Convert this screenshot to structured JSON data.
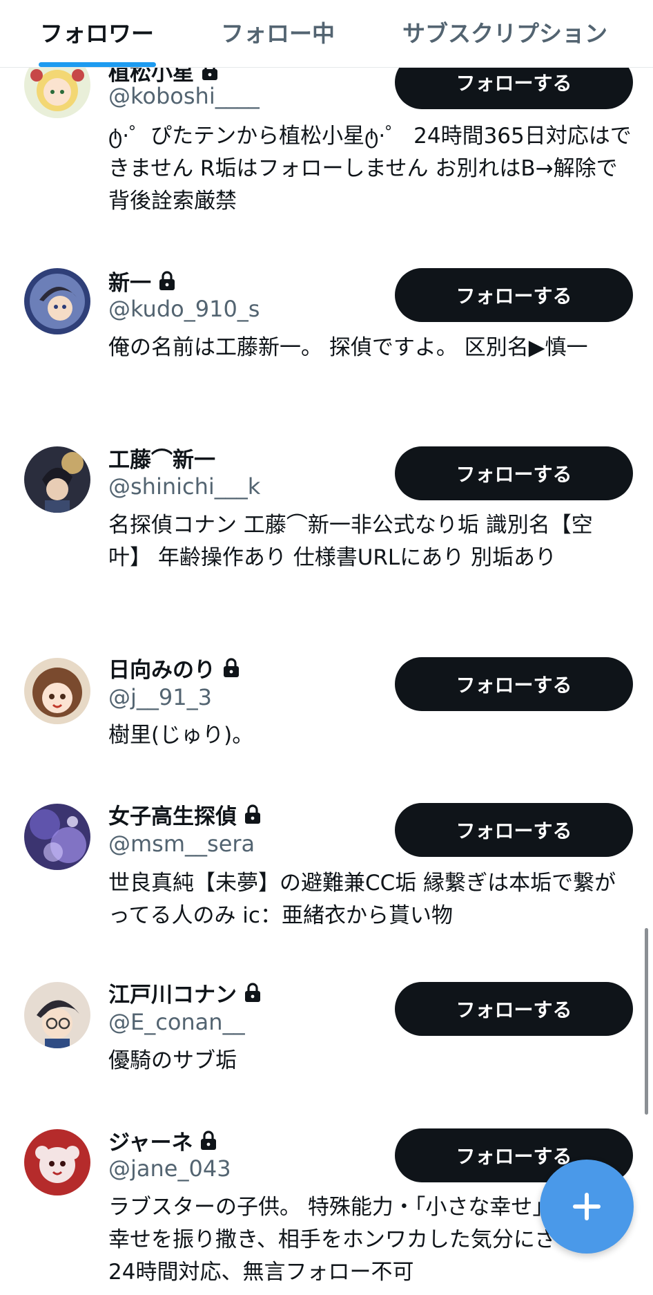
{
  "tabs": [
    {
      "label": "フォロワー",
      "active": true
    },
    {
      "label": "フォロー中",
      "active": false
    },
    {
      "label": "サブスクリプション",
      "active": false
    }
  ],
  "follow_label": "フォローする",
  "users": [
    {
      "name": "植松小星",
      "handle": "@koboshi____",
      "locked": true,
      "bio": "ტ·゜ぴたテンから植松小星ტ·゜ 24時間365日対応はできません R垢はフォローしません お別れはB→解除で 背後詮索厳禁",
      "avatar_icon": "avatar-anime-blonde-girl"
    },
    {
      "name": "新一",
      "handle": "@kudo_910_s",
      "locked": true,
      "bio": "俺の名前は工藤新一。 探偵ですよ。 区別名▶慎一",
      "avatar_icon": "avatar-anime-boy-blue"
    },
    {
      "name": "工藤⌒新一",
      "handle": "@shinichi___k",
      "locked": false,
      "bio": "名探偵コナン 工藤⌒新一非公式なり垢 識別名【空叶】 年齢操作あり 仕様書URLにあり 別垢あり",
      "avatar_icon": "avatar-anime-boy-dark"
    },
    {
      "name": "日向みのり",
      "handle": "@j__91_3",
      "locked": true,
      "bio": "樹里(じゅり)。",
      "avatar_icon": "avatar-anime-girl-brown"
    },
    {
      "name": "女子高生探偵",
      "handle": "@msm__sera",
      "locked": true,
      "bio": "世良真純【未夢】の避難兼CC垢 縁繋ぎは本垢で繋がってる人のみ ic：亜緒衣から貰い物",
      "avatar_icon": "avatar-anime-purple"
    },
    {
      "name": "江戸川コナン",
      "handle": "@E_conan__",
      "locked": true,
      "bio": "優騎のサブ垢",
      "avatar_icon": "avatar-anime-boy-glasses"
    },
    {
      "name": "ジャーネ",
      "handle": "@jane_043",
      "locked": true,
      "bio": "ラブスターの子供。 特殊能力・「小さな幸せ」周囲に幸せを振り撒き、相手をホンワカした気分にさせる。24時間対応、無言フォロー不可",
      "avatar_icon": "avatar-red-mascot"
    }
  ],
  "fab": {
    "icon": "plus-icon",
    "color": "#4a99e9"
  },
  "colors": {
    "accent": "#1d9bf0",
    "button_bg": "#0f1419",
    "secondary_text": "#536471"
  }
}
